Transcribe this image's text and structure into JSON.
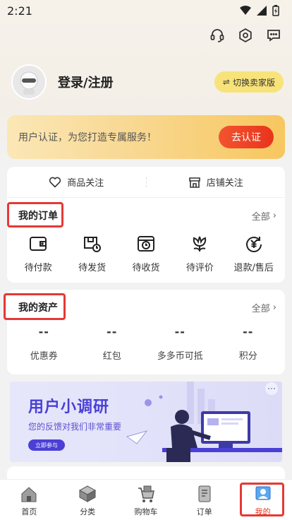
{
  "status_bar": {
    "time": "2:21"
  },
  "profile": {
    "login_label": "登录/注册",
    "seller_button": "切换卖家版"
  },
  "auth_banner": {
    "text": "用户认证，为您打造专属服务！",
    "button": "去认证"
  },
  "follow": {
    "goods": "商品关注",
    "shops": "店铺关注"
  },
  "orders": {
    "title": "我的订单",
    "more": "全部",
    "items": [
      {
        "label": "待付款",
        "icon": "wallet-icon"
      },
      {
        "label": "待发货",
        "icon": "truck-icon"
      },
      {
        "label": "待收货",
        "icon": "box-clock-icon"
      },
      {
        "label": "待评价",
        "icon": "flower-icon"
      },
      {
        "label": "退款/售后",
        "icon": "refund-icon"
      }
    ]
  },
  "assets": {
    "title": "我的资产",
    "more": "全部",
    "items": [
      {
        "value": "--",
        "label": "优惠券"
      },
      {
        "value": "--",
        "label": "红包"
      },
      {
        "value": "--",
        "label": "多多币可抵"
      },
      {
        "value": "--",
        "label": "积分"
      }
    ]
  },
  "survey": {
    "title": "用户小调研",
    "subtitle": "您的反馈对我们非常重要",
    "button": "立即参与"
  },
  "tabbar": {
    "items": [
      {
        "label": "首页",
        "icon": "home-icon"
      },
      {
        "label": "分类",
        "icon": "category-icon"
      },
      {
        "label": "购物车",
        "icon": "cart-icon"
      },
      {
        "label": "订单",
        "icon": "order-icon"
      },
      {
        "label": "我的",
        "icon": "profile-icon",
        "active": true
      }
    ]
  },
  "colors": {
    "accent": "#e8341c",
    "seller_button": "#f7e37a",
    "survey_purple": "#4a3fd6",
    "highlight": "#e53935"
  }
}
